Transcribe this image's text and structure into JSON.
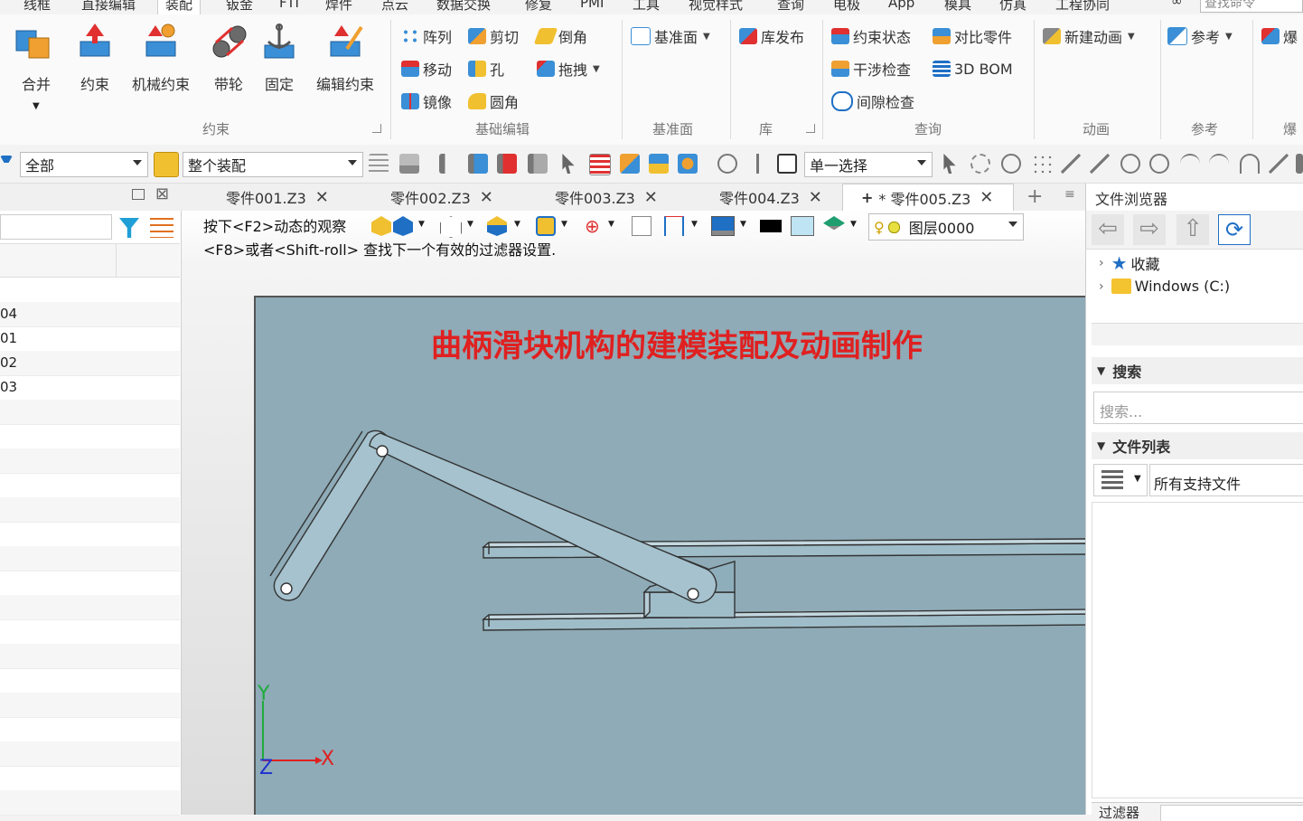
{
  "menubar": {
    "tabs": [
      "线框",
      "直接编辑",
      "装配",
      "钣金",
      "FTI",
      "焊件",
      "点云",
      "数据交换",
      "修复",
      "PMI",
      "工具",
      "视觉样式",
      "查询",
      "电极",
      "App",
      "模具",
      "仿真",
      "工程协同"
    ],
    "active": "装配",
    "search_placeholder": "查找命令"
  },
  "ribbon": {
    "merge_label": "合并",
    "constraint_group": {
      "title": "约束",
      "buttons": [
        "约束",
        "机械约束",
        "带轮",
        "固定",
        "编辑约束"
      ]
    },
    "basic_edit_group": {
      "title": "基础编辑",
      "items": [
        "阵列",
        "剪切",
        "倒角",
        "移动",
        "孔",
        "拖拽",
        "镜像",
        "圆角"
      ]
    },
    "datum_group": {
      "title": "基准面",
      "item": "基准面"
    },
    "library_group": {
      "title": "库",
      "item": "库发布"
    },
    "query_group": {
      "title": "查询",
      "items": [
        "约束状态",
        "对比零件",
        "干涉检查",
        "3D BOM",
        "间隙检查"
      ]
    },
    "animation_group": {
      "title": "动画",
      "item": "新建动画"
    },
    "reference_group": {
      "title": "参考",
      "item": "参考"
    },
    "explode_group": {
      "title": "爆",
      "item": "爆"
    }
  },
  "toolbar": {
    "filter_value": "全部",
    "assembly_value": "整个装配",
    "select_value": "单一选择"
  },
  "tabs": {
    "docs": [
      "零件001.Z3",
      "零件002.Z3",
      "零件003.Z3",
      "零件004.Z3",
      "* 零件005.Z3"
    ],
    "active_prefix": "+"
  },
  "leftpanel": {
    "rows": [
      "04",
      "01",
      "02",
      "03"
    ]
  },
  "viewport": {
    "hint1": "按下<F2>动态的观察",
    "hint2": "<F8>或者<Shift-roll> 查找下一个有效的过滤器设置.",
    "layer_value": "图层0000",
    "title": "曲柄滑块机构的建模装配及动画制作",
    "axes": {
      "x": "X",
      "y": "Y",
      "z": "Z"
    }
  },
  "rightpanel": {
    "title": "文件浏览器",
    "tree": [
      "收藏",
      "Windows (C:)"
    ],
    "search_title": "搜索",
    "search_placeholder": "搜索...",
    "file_list_title": "文件列表",
    "file_filter": "所有支持文件",
    "bottom_label": "过滤器"
  },
  "colors": {
    "accent": "#1f6fc5",
    "title_red": "#e02020",
    "canvas": "#8eabb7"
  }
}
